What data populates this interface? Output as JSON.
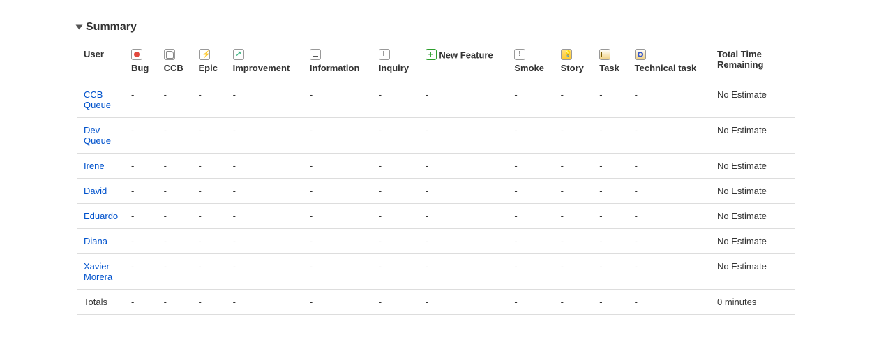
{
  "section": {
    "title": "Summary"
  },
  "columns": {
    "user": "User",
    "types": [
      "Bug",
      "CCB",
      "Epic",
      "Improvement",
      "Information",
      "Inquiry",
      "New Feature",
      "Smoke",
      "Story",
      "Task",
      "Technical task"
    ],
    "totalTime": "Total Time Remaining"
  },
  "rows": [
    {
      "user": "CCB Queue",
      "cells": [
        "-",
        "-",
        "-",
        "-",
        "-",
        "-",
        "-",
        "-",
        "-",
        "-",
        "-"
      ],
      "total": "No Estimate"
    },
    {
      "user": "Dev Queue",
      "cells": [
        "-",
        "-",
        "-",
        "-",
        "-",
        "-",
        "-",
        "-",
        "-",
        "-",
        "-"
      ],
      "total": "No Estimate"
    },
    {
      "user": "Irene",
      "cells": [
        "-",
        "-",
        "-",
        "-",
        "-",
        "-",
        "-",
        "-",
        "-",
        "-",
        "-"
      ],
      "total": "No Estimate"
    },
    {
      "user": "David",
      "cells": [
        "-",
        "-",
        "-",
        "-",
        "-",
        "-",
        "-",
        "-",
        "-",
        "-",
        "-"
      ],
      "total": "No Estimate"
    },
    {
      "user": "Eduardo",
      "cells": [
        "-",
        "-",
        "-",
        "-",
        "-",
        "-",
        "-",
        "-",
        "-",
        "-",
        "-"
      ],
      "total": "No Estimate"
    },
    {
      "user": "Diana",
      "cells": [
        "-",
        "-",
        "-",
        "-",
        "-",
        "-",
        "-",
        "-",
        "-",
        "-",
        "-"
      ],
      "total": "No Estimate"
    },
    {
      "user": "Xavier Morera",
      "cells": [
        "-",
        "-",
        "-",
        "-",
        "-",
        "-",
        "-",
        "-",
        "-",
        "-",
        "-"
      ],
      "total": "No Estimate"
    }
  ],
  "totals": {
    "label": "Totals",
    "cells": [
      "-",
      "-",
      "-",
      "-",
      "-",
      "-",
      "-",
      "-",
      "-",
      "-",
      "-"
    ],
    "total": "0 minutes"
  }
}
